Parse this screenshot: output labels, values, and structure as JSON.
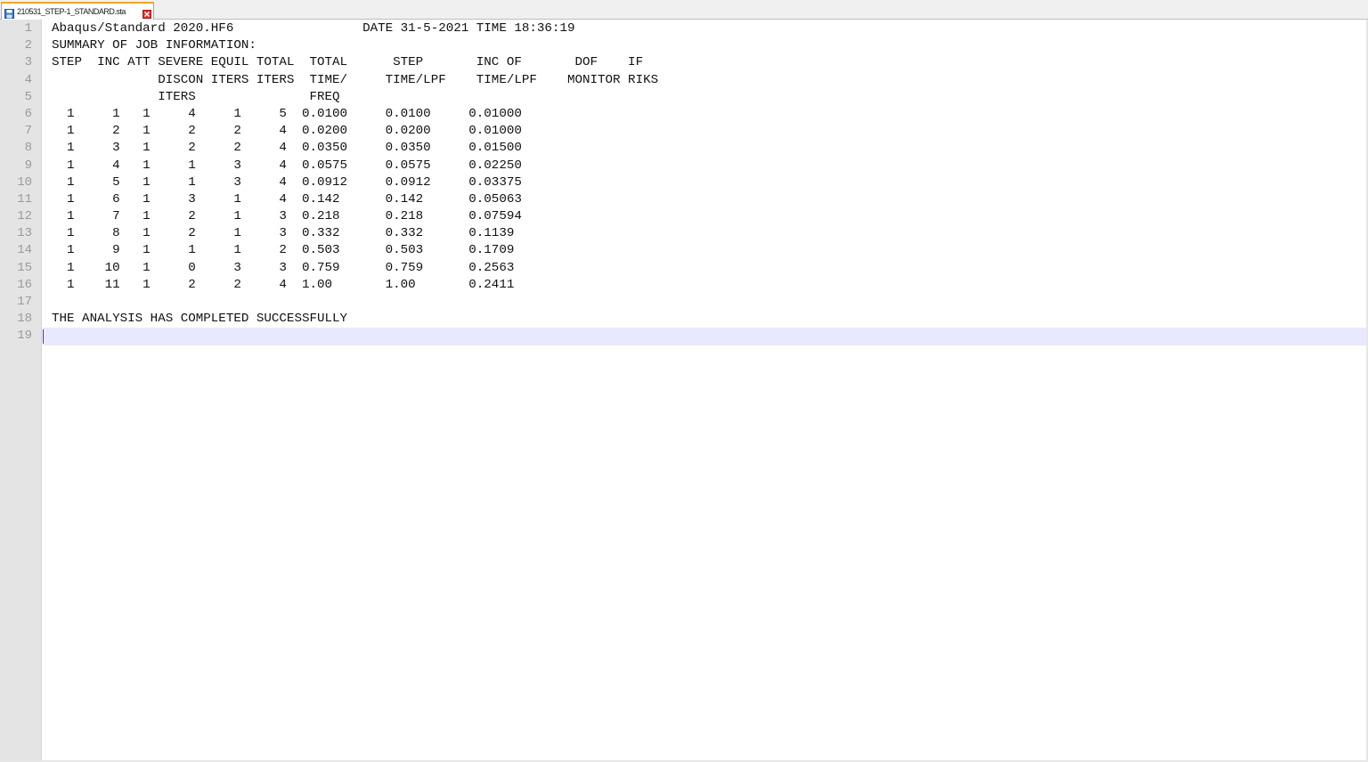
{
  "tab": {
    "filename": "210531_STEP-1_STANDARD.sta",
    "icon": "save-icon",
    "close_icon": "close-icon",
    "accent_color": "#f5a623",
    "close_color": "#e0302a"
  },
  "editor": {
    "current_line": 19,
    "lines": [
      {
        "num": "1",
        "text": "Abaqus/Standard 2020.HF6                 DATE 31-5-2021 TIME 18:36:19"
      },
      {
        "num": "2",
        "text": "SUMMARY OF JOB INFORMATION:"
      },
      {
        "num": "3",
        "text": "STEP  INC ATT SEVERE EQUIL TOTAL  TOTAL      STEP       INC OF       DOF    IF"
      },
      {
        "num": "4",
        "text": "              DISCON ITERS ITERS  TIME/     TIME/LPF    TIME/LPF    MONITOR RIKS"
      },
      {
        "num": "5",
        "text": "              ITERS               FREQ"
      },
      {
        "num": "6",
        "text": "  1     1   1     4     1     5  0.0100     0.0100     0.01000"
      },
      {
        "num": "7",
        "text": "  1     2   1     2     2     4  0.0200     0.0200     0.01000"
      },
      {
        "num": "8",
        "text": "  1     3   1     2     2     4  0.0350     0.0350     0.01500"
      },
      {
        "num": "9",
        "text": "  1     4   1     1     3     4  0.0575     0.0575     0.02250"
      },
      {
        "num": "10",
        "text": "  1     5   1     1     3     4  0.0912     0.0912     0.03375"
      },
      {
        "num": "11",
        "text": "  1     6   1     3     1     4  0.142      0.142      0.05063"
      },
      {
        "num": "12",
        "text": "  1     7   1     2     1     3  0.218      0.218      0.07594"
      },
      {
        "num": "13",
        "text": "  1     8   1     2     1     3  0.332      0.332      0.1139"
      },
      {
        "num": "14",
        "text": "  1     9   1     1     1     2  0.503      0.503      0.1709"
      },
      {
        "num": "15",
        "text": "  1    10   1     0     3     3  0.759      0.759      0.2563"
      },
      {
        "num": "16",
        "text": "  1    11   1     2     2     4  1.00       1.00       0.2411"
      },
      {
        "num": "17",
        "text": ""
      },
      {
        "num": "18",
        "text": "THE ANALYSIS HAS COMPLETED SUCCESSFULLY"
      },
      {
        "num": "19",
        "text": ""
      }
    ]
  }
}
